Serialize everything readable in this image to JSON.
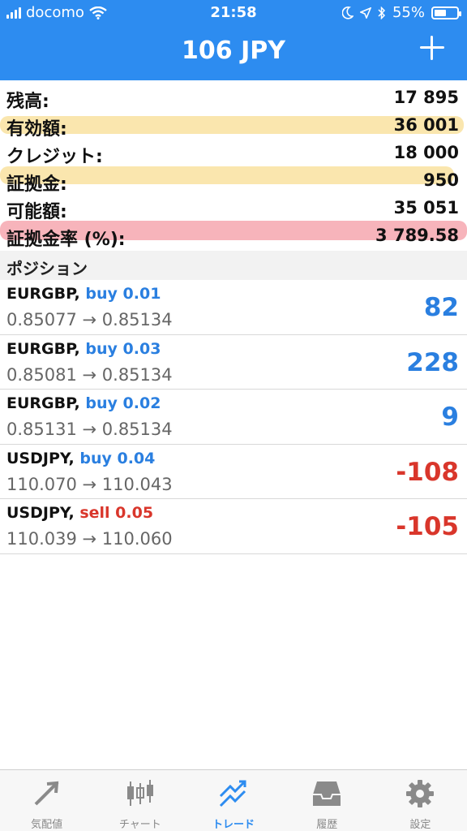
{
  "status_bar": {
    "carrier": "docomo",
    "time": "21:58",
    "battery": "55%",
    "battery_level": 0.55
  },
  "nav": {
    "title": "106 JPY"
  },
  "summary": [
    {
      "label": "残高:",
      "value": "17 895"
    },
    {
      "label": "有効額:",
      "value": "36 001"
    },
    {
      "label": "クレジット:",
      "value": "18 000"
    },
    {
      "label": "証拠金:",
      "value": "950"
    },
    {
      "label": "可能額:",
      "value": "35 051"
    },
    {
      "label": "証拠金率 (%):",
      "value": "3 789.58"
    }
  ],
  "positions_header": "ポジション",
  "positions": [
    {
      "symbol": "EURGBP,",
      "side": "buy 0.01",
      "prices": "0.85077 → 0.85134",
      "profit": "82"
    },
    {
      "symbol": "EURGBP,",
      "side": "buy 0.03",
      "prices": "0.85081 → 0.85134",
      "profit": "228"
    },
    {
      "symbol": "EURGBP,",
      "side": "buy 0.02",
      "prices": "0.85131 → 0.85134",
      "profit": "9"
    },
    {
      "symbol": "USDJPY,",
      "side": "buy 0.04",
      "prices": "110.070 → 110.043",
      "profit": "-108"
    },
    {
      "symbol": "USDJPY,",
      "side": "sell 0.05",
      "prices": "110.039 → 110.060",
      "profit": "-105"
    }
  ],
  "tabs": [
    {
      "label": "気配値",
      "icon": "quotes-icon"
    },
    {
      "label": "チャート",
      "icon": "chart-icon"
    },
    {
      "label": "トレード",
      "icon": "trade-icon"
    },
    {
      "label": "履歴",
      "icon": "history-icon"
    },
    {
      "label": "設定",
      "icon": "settings-icon"
    }
  ],
  "colors": {
    "accent": "#2d8cf0",
    "profit_positive": "#2a7fe0",
    "profit_negative": "#d9362b"
  }
}
